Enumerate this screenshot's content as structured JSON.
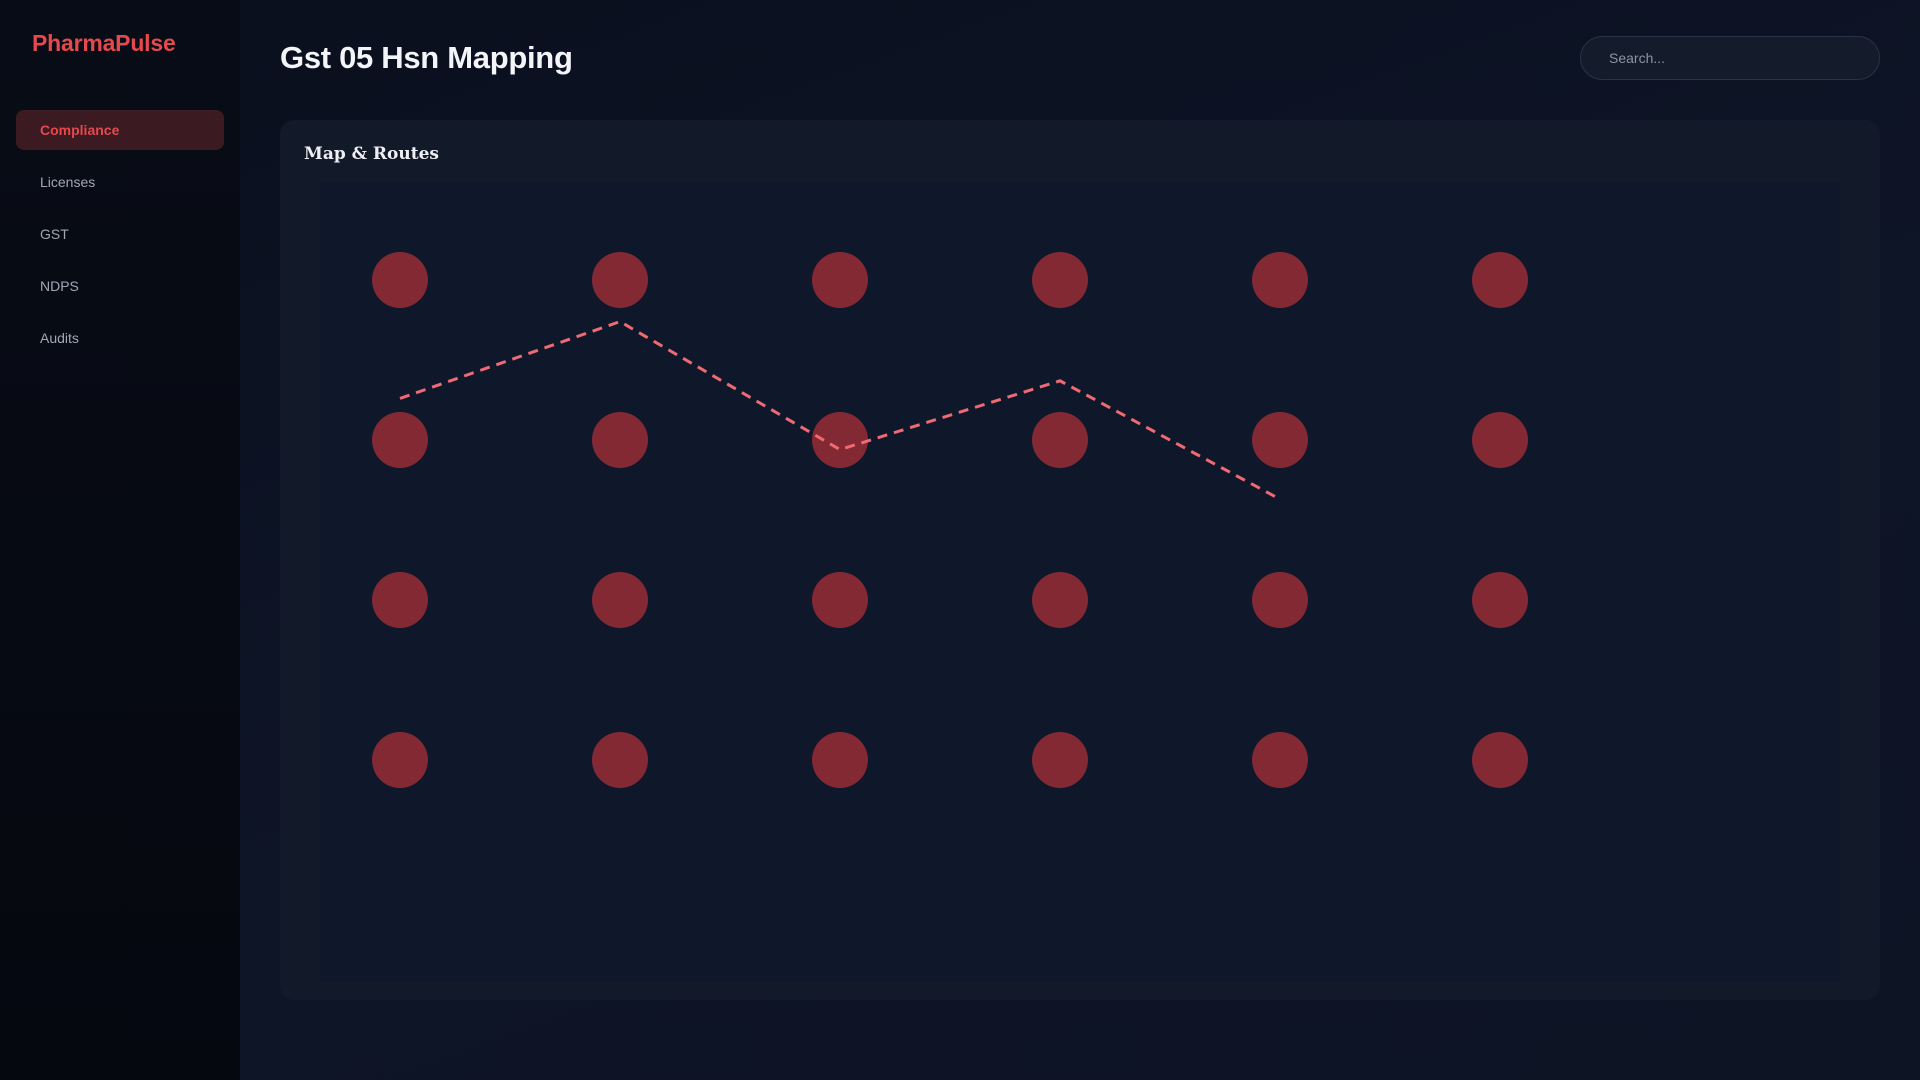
{
  "app": {
    "brand": "PharmaPulse",
    "accent_color": "#e5484d"
  },
  "sidebar": {
    "items": [
      {
        "label": "Compliance",
        "active": true
      },
      {
        "label": "Licenses",
        "active": false
      },
      {
        "label": "GST",
        "active": false
      },
      {
        "label": "NDPS",
        "active": false
      },
      {
        "label": "Audits",
        "active": false
      }
    ]
  },
  "header": {
    "title": "Gst 05 Hsn Mapping",
    "search_placeholder": "Search..."
  },
  "card": {
    "title": "Map & Routes",
    "map": {
      "grid_rows": 4,
      "grid_cols": 6,
      "marker_color": "#8a2a35",
      "route_color": "#f06a73",
      "route_style": "dashed",
      "route_stops": [
        {
          "col": 0,
          "row_offset": 0.74
        },
        {
          "col": 1,
          "row_offset": 0.26
        },
        {
          "col": 2,
          "row_offset": 1.06
        },
        {
          "col": 3,
          "row_offset": 0.63
        },
        {
          "col": 4,
          "row_offset": 1.37
        }
      ]
    }
  }
}
